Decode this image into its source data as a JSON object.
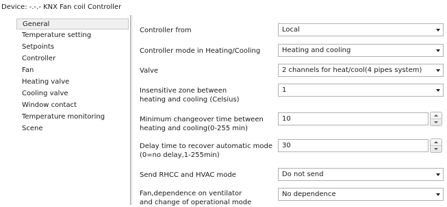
{
  "device_title": "Device: -.-.-  KNX Fan coil Controller",
  "sidebar": {
    "items": [
      {
        "label": "General",
        "selected": true
      },
      {
        "label": "Temperature setting"
      },
      {
        "label": "Setpoints"
      },
      {
        "label": "Controller"
      },
      {
        "label": "Fan"
      },
      {
        "label": "Heating valve"
      },
      {
        "label": "Cooling valve"
      },
      {
        "label": "Window contact"
      },
      {
        "label": "Temperature monitoring"
      },
      {
        "label": "Scene"
      }
    ]
  },
  "params": [
    {
      "label": "Controller from",
      "type": "dropdown",
      "value": "Local"
    },
    {
      "label": "Controller mode in Heating/Cooling",
      "type": "dropdown",
      "value": "Heating and cooling"
    },
    {
      "label": "Valve",
      "type": "dropdown",
      "value": "2 channels for heat/cool(4 pipes system)"
    },
    {
      "label": "Insensitive zone between\nheating and cooling (Celsius)",
      "type": "dropdown",
      "value": "1"
    },
    {
      "label": "Minimum changeover time between\nheating and cooling(0-255 min)",
      "type": "stepper",
      "value": "10"
    },
    {
      "label": "Delay time to recover automatic mode\n(0=no delay,1-255min)",
      "type": "stepper",
      "value": "30"
    },
    {
      "label": "Send RHCC and HVAC mode",
      "type": "dropdown",
      "value": "Do not send"
    },
    {
      "label": "Fan,dependence on ventilator\nand change of operational mode",
      "type": "dropdown",
      "value": "No dependence"
    }
  ]
}
